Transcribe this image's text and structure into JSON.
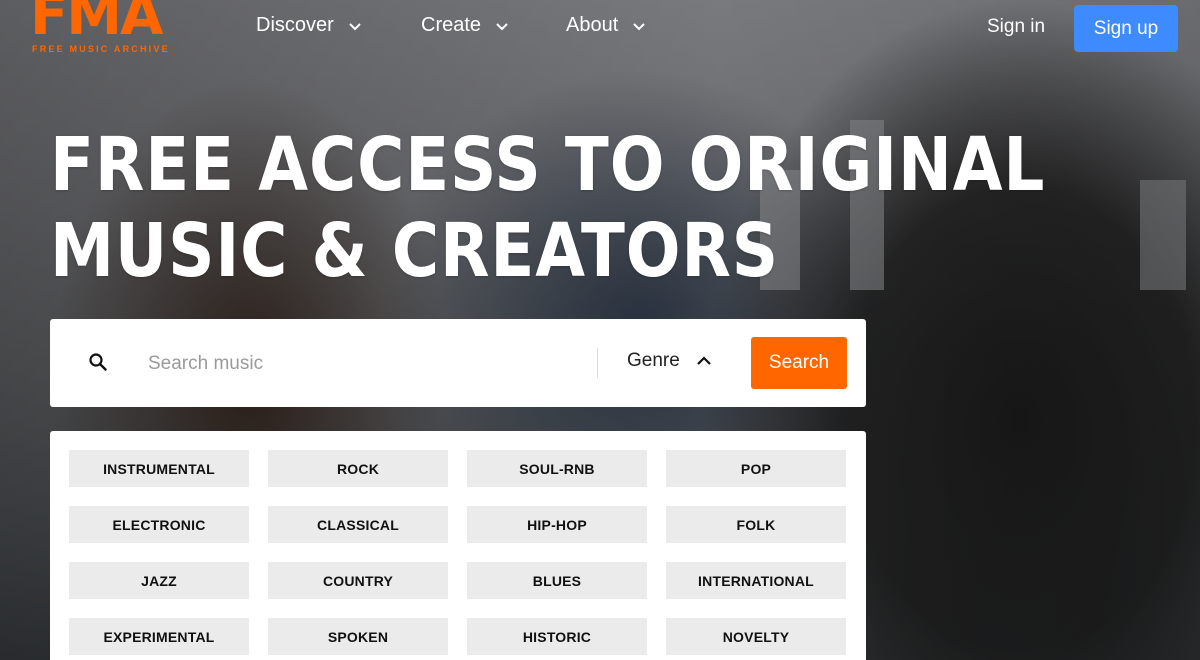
{
  "brand": {
    "logo_text": "FMA",
    "logo_subtitle": "FREE MUSIC ARCHIVE",
    "accent_color": "#ff6600",
    "signup_color": "#3d8bff"
  },
  "nav": {
    "items": [
      {
        "label": "Discover",
        "icon": "chevron-down-icon"
      },
      {
        "label": "Create",
        "icon": "chevron-down-icon"
      },
      {
        "label": "About",
        "icon": "chevron-down-icon"
      }
    ],
    "sign_in": "Sign in",
    "sign_up": "Sign up"
  },
  "hero": {
    "headline_line1": "FREE ACCESS TO ORIGINAL",
    "headline_line2": "MUSIC & CREATORS"
  },
  "search": {
    "placeholder": "Search music",
    "value": "",
    "genre_label": "Genre",
    "genre_icon": "chevron-up-icon",
    "button_label": "Search"
  },
  "genres": [
    "INSTRUMENTAL",
    "ROCK",
    "SOUL-RNB",
    "POP",
    "ELECTRONIC",
    "CLASSICAL",
    "HIP-HOP",
    "FOLK",
    "JAZZ",
    "COUNTRY",
    "BLUES",
    "INTERNATIONAL",
    "EXPERIMENTAL",
    "SPOKEN",
    "HISTORIC",
    "NOVELTY"
  ]
}
